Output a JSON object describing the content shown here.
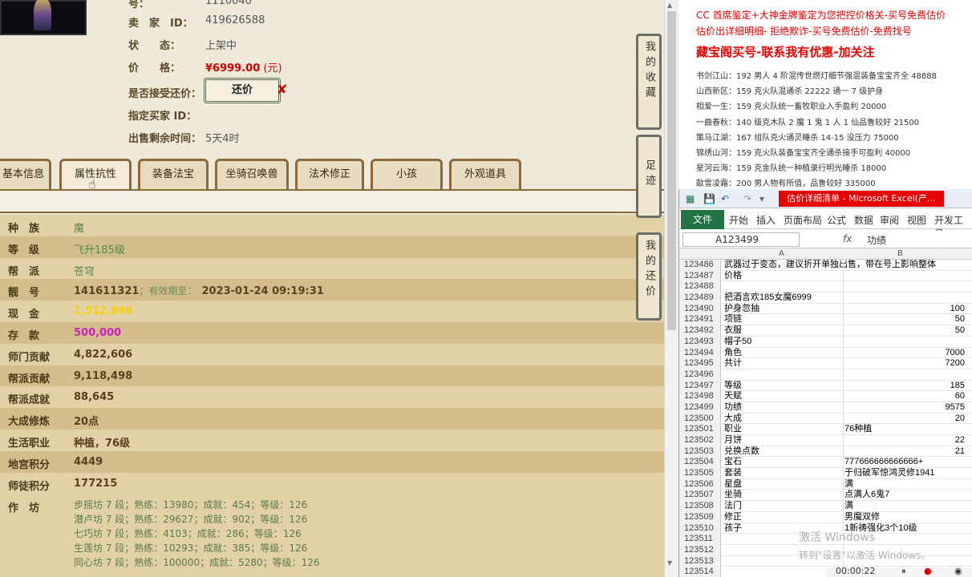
{
  "product": {
    "num_label": "号：",
    "num_value": "1110040",
    "seller_label": "卖　家　ID：",
    "seller_value": "419626588",
    "status_label": "状　　态：",
    "status_value": "上架中",
    "price_label": "价　　格：",
    "price_value": "¥6999.00",
    "price_unit": "(元)",
    "counter_label": "是否接受还价：",
    "counter_button": "还价",
    "buyer_label": "指定买家 ID：",
    "remain_label": "出售剩余时间：",
    "remain_value": "5天4时"
  },
  "tabs": [
    "基本信息",
    "属性抗性",
    "装备法宝",
    "坐骑召唤兽",
    "法术修正",
    "小孩",
    "外观道具"
  ],
  "side_buttons": [
    "我的收藏",
    "足迹",
    "我的还价"
  ],
  "attributes": [
    {
      "label": "种　族",
      "value": "魔",
      "style": "green"
    },
    {
      "label": "等　级",
      "value": "飞升185级",
      "style": "green"
    },
    {
      "label": "帮　派",
      "value": "苍穹",
      "style": "green"
    },
    {
      "label": "靓　号",
      "value": "141611321",
      "extra_label": "有效期至：",
      "extra_value": "2023-01-24 09:19:31",
      "style": "bold"
    },
    {
      "label": "现　金",
      "value": "1,512,896",
      "style": "yellow"
    },
    {
      "label": "存　款",
      "value": "500,000",
      "style": "magenta"
    },
    {
      "label": "师门贡献",
      "value": "4,822,606",
      "style": "bold"
    },
    {
      "label": "帮派贡献",
      "value": "9,118,498",
      "style": "bold"
    },
    {
      "label": "帮派成就",
      "value": "88,645",
      "style": "bold"
    },
    {
      "label": "大成修炼",
      "value": "20点",
      "style": "bold"
    },
    {
      "label": "生活职业",
      "value": "种植，76级",
      "style": "bold"
    },
    {
      "label": "地宫积分",
      "value": "4449",
      "style": "bold"
    },
    {
      "label": "师徒积分",
      "value": "177215",
      "style": "bold"
    }
  ],
  "workshop_label": "作　坊",
  "workshops": [
    "步摇坊 7 段；熟练：13980；成就：454；等级：126",
    "潜卢坊 7 段；熟练：29627；成就：902；等级：126",
    "七巧坊 7 段；熟练：4103；成就：286；等级：126",
    "生莲坊 7 段；熟练：10293；成就：385；等级：126",
    "同心坊 7 段；熟练：100000；成就：5280；等级：126"
  ],
  "ad": {
    "line0": "CC 首席鉴定+大神金牌鉴定为您把控价格关-买号免费估价",
    "line1": "估价出详细明细- 拒绝欺诈-买号免费估价-免费找号",
    "title": "藏宝阁买号-联系我有优惠-加关注",
    "listings": [
      "书剑江山：192 男人 4 阶混传世燃灯细节强混装备宝宝齐全 48888",
      "山西新区：159 克火队混通杀 22222 通一 7 级护身",
      "相爱一生：159 克火队统一畜牧职业入手盈利 20000",
      "一曲春秋：140 级克木队 2 魔 1 鬼 1 人 1 仙品鲁较好 21500",
      "策马江湖：167 组队克火通灵睡杀 14-15 没压力 75000",
      "锦绣山河：159 克火队装备宝宝齐全通杀接手可盈利 40000",
      "星河云海：159 克金队统一种植录行明光睡杀 18000",
      "歃雪凌霜：200 男人物有所值，品鲁较好 335000"
    ]
  },
  "excel": {
    "window_title": "估价详细清单 - Microsoft Excel(产...",
    "file_tab": "文件",
    "menus": [
      "开始",
      "插入",
      "页面布局",
      "公式",
      "数据",
      "审阅",
      "视图",
      "开发工具"
    ],
    "name_box": "A123499",
    "fx": "fx",
    "formula_value": "功绩",
    "col_a": "A",
    "col_b": "B",
    "rows": [
      {
        "n": "123486",
        "a": "武器过于变态，建议折开单独出售，带在号上影响整体",
        "b": ""
      },
      {
        "n": "123487",
        "a": "价格",
        "b": ""
      },
      {
        "n": "123488",
        "a": "",
        "b": ""
      },
      {
        "n": "123489",
        "a": "把酒言欢185女魔6999",
        "b": ""
      },
      {
        "n": "123490",
        "a": "护身忽抽",
        "b": "100"
      },
      {
        "n": "123491",
        "a": "项链",
        "b": "50"
      },
      {
        "n": "123492",
        "a": "衣服",
        "b": "50"
      },
      {
        "n": "123493",
        "a": "帽子50",
        "b": ""
      },
      {
        "n": "123494",
        "a": "角色",
        "b": "7000"
      },
      {
        "n": "123495",
        "a": "共计",
        "b": "7200"
      },
      {
        "n": "123496",
        "a": "",
        "b": ""
      },
      {
        "n": "123497",
        "a": "等级",
        "b": "185"
      },
      {
        "n": "123498",
        "a": "天赋",
        "b": "60"
      },
      {
        "n": "123499",
        "a": "功绩",
        "b": "9575"
      },
      {
        "n": "123500",
        "a": "大成",
        "b": "20"
      },
      {
        "n": "123501",
        "a": "职业",
        "b": "76种植",
        "text": true
      },
      {
        "n": "123502",
        "a": "月饼",
        "b": "22"
      },
      {
        "n": "123503",
        "a": "兑换点数",
        "b": "21"
      },
      {
        "n": "123504",
        "a": "宝石",
        "b": "777666666666666+",
        "text": true
      },
      {
        "n": "123505",
        "a": "套装",
        "b": "于归破军惊鸿灵修1941",
        "text": true
      },
      {
        "n": "123506",
        "a": "星盘",
        "b": "满",
        "text": true
      },
      {
        "n": "123507",
        "a": "坐骑",
        "b": "点满人6鬼7",
        "text": true
      },
      {
        "n": "123508",
        "a": "法门",
        "b": "满",
        "text": true
      },
      {
        "n": "123509",
        "a": "修正",
        "b": "男魔双修",
        "text": true
      },
      {
        "n": "123510",
        "a": "孩子",
        "b": "1新祷强化3个10级",
        "text": true
      },
      {
        "n": "123511",
        "a": "",
        "b": ""
      },
      {
        "n": "123512",
        "a": "",
        "b": ""
      },
      {
        "n": "123513",
        "a": "",
        "b": ""
      },
      {
        "n": "123514",
        "a": "",
        "b": ""
      }
    ]
  },
  "watermark": {
    "line1": "激活 Windows",
    "line2": "转到\"设置\"以激活 Windows。"
  },
  "recorder": {
    "time": "00:00:22"
  }
}
